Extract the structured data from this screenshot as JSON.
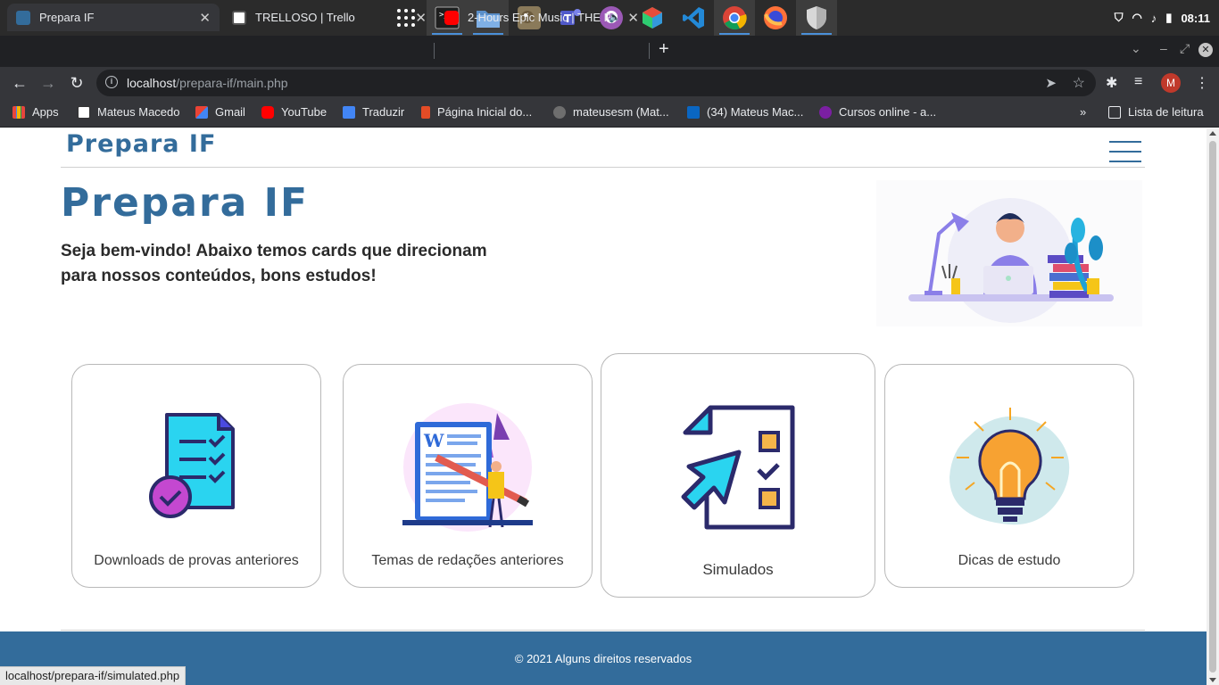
{
  "os": {
    "clock": "08:11",
    "apps": [
      "app-grid-icon",
      "terminal-icon",
      "files-icon",
      "gimp-icon",
      "teams-icon",
      "github-icon",
      "virtualbox-icon",
      "vscode-icon",
      "chrome-icon",
      "firefox-icon",
      "shield-icon"
    ]
  },
  "browser": {
    "tabs": [
      {
        "title": "Prepara IF",
        "active": true
      },
      {
        "title": "TRELLOSO | Trello",
        "active": false
      },
      {
        "title": "2-Hours Epic Music | THE P",
        "active": false
      }
    ],
    "url_host": "localhost",
    "url_path": "/prepara-if/main.php",
    "profile_initial": "M",
    "bookmarks": [
      {
        "label": "Apps",
        "color": "#e8453c"
      },
      {
        "label": "Mateus Macedo",
        "color": "#ffffff"
      },
      {
        "label": "Gmail",
        "color": "#ea4335"
      },
      {
        "label": "YouTube",
        "color": "#ff0000"
      },
      {
        "label": "Traduzir",
        "color": "#4285f4"
      },
      {
        "label": "Página Inicial do...",
        "color": "#e34c26"
      },
      {
        "label": "mateusesm (Mat...",
        "color": "#6e6e6e"
      },
      {
        "label": "(34) Mateus Mac...",
        "color": "#0a66c2"
      },
      {
        "label": "Cursos online - a...",
        "color": "#7b1fa2"
      }
    ],
    "reading_list": "Lista de leitura",
    "status_url": "localhost/prepara-if/simulated.php"
  },
  "site": {
    "brand": "Prepara IF",
    "hero_title": "Prepara IF",
    "hero_text": "Seja bem-vindo! Abaixo temos cards que direcionam para nossos conteúdos, bons estudos!",
    "brand_color": "#336c9b",
    "cards": [
      {
        "label": "Downloads de provas anteriores",
        "icon": "checklist-icon"
      },
      {
        "label": "Temas de redações anteriores",
        "icon": "essay-writing-icon"
      },
      {
        "label": "Simulados",
        "icon": "quiz-icon"
      },
      {
        "label": "Dicas de estudo",
        "icon": "lightbulb-icon"
      }
    ],
    "footer": "© 2021 Alguns direitos reservados"
  }
}
